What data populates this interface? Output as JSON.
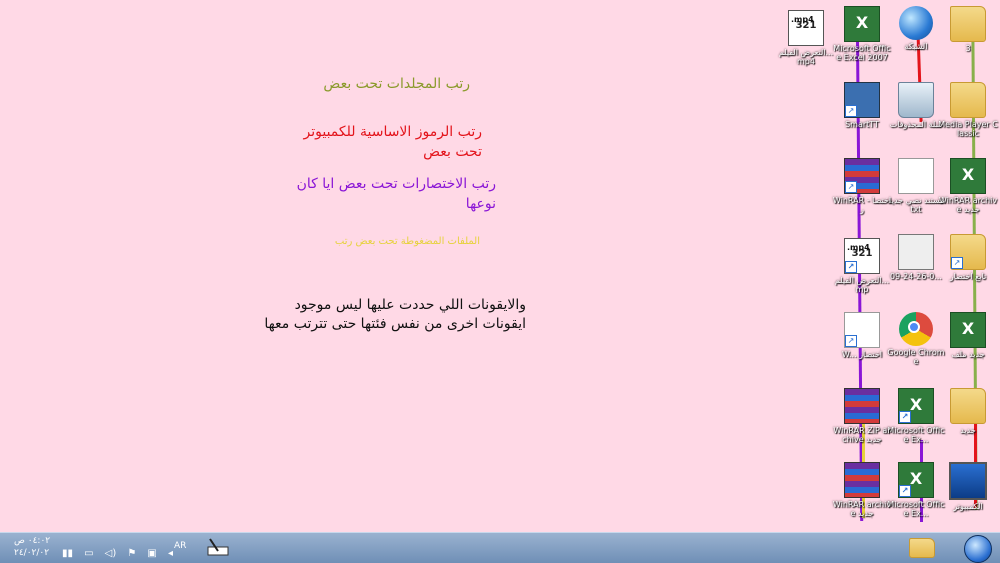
{
  "colors": {
    "desktop_bg": "#ffd9e6",
    "line_yellow": "#e6d23a",
    "line_green": "#88b04b",
    "line_red": "#e3141b",
    "line_purple": "#8a16d6"
  },
  "notes": {
    "folders": "رتب المجلدات تحت بعض",
    "system_icons": "رتب الرموز الاساسية للكمبيوتر تحت بعض",
    "shortcuts": "رتب الاختصارات تحت بعض ايا كان نوعها",
    "compressed": "الملفات المضغوطة تحت بعض رتب",
    "remark_line1": "والايقونات اللي حددت عليها ليس موجود",
    "remark_line2": "ايقونات اخرى من نفس فئتها حتى تترتب معها"
  },
  "icons": {
    "col1": [
      {
        "label": "3",
        "type": "folder"
      },
      {
        "label": "Media Player Classic",
        "type": "folder"
      },
      {
        "label": "WinRAR archive جديد",
        "type": "excel"
      },
      {
        "label": "تابع اختصار",
        "type": "folder"
      },
      {
        "label": "جديد ملف",
        "type": "excel"
      },
      {
        "label": "جديد",
        "type": "folder"
      },
      {
        "label": "الكمبيوتر",
        "type": "monitor"
      }
    ],
    "col2": [
      {
        "label": "الشبكة",
        "type": "globe"
      },
      {
        "label": "سلة المحذوفات",
        "type": "bin"
      },
      {
        "label": "مستند نصي جديد txt",
        "type": "doc"
      },
      {
        "label": "09-24-26-0...",
        "type": "keyboard"
      },
      {
        "label": "Google Chrome",
        "type": "chrome"
      },
      {
        "label": "Microsoft Office Ex...",
        "type": "excel"
      },
      {
        "label": "Microsoft Office Ex...",
        "type": "excel"
      }
    ],
    "col3": [
      {
        "label": "Microsoft Office Excel 2007",
        "type": "excel"
      },
      {
        "label": "SmartTT",
        "type": "sketch"
      },
      {
        "label": "WinRAR - اختصار",
        "type": "winrar"
      },
      {
        "label": "التعرض الفيلم...mp",
        "type": "media",
        "tag": ".mp4"
      },
      {
        "label": "W... اختصار",
        "type": "doc"
      },
      {
        "label": "WinRAR ZIP archive جديد",
        "type": "winrar"
      },
      {
        "label": "WinRAR archive جديد",
        "type": "winrar"
      }
    ],
    "col4": [
      {
        "label": "التعرض الفيلم... mp4",
        "type": "media",
        "tag": ".mp4"
      }
    ]
  },
  "taskbar": {
    "clock_time": "٠٤:٠٢ ص",
    "clock_date": "٢٤/٠٢/٠٢",
    "language": "AR",
    "tray_icons": [
      "signal-icon",
      "battery-icon",
      "volume-icon",
      "flag-icon",
      "network-icon",
      "chevron-icon"
    ]
  }
}
